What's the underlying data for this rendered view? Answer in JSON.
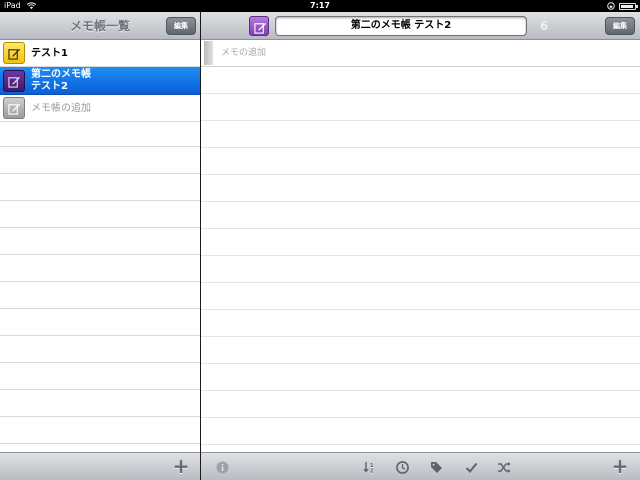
{
  "status_bar": {
    "device": "iPad",
    "time": "7:17"
  },
  "left_pane": {
    "title": "メモ帳一覧",
    "edit_label": "編集",
    "notebooks": [
      {
        "label": "テスト1",
        "icon": "notebook-yellow-icon",
        "color": "#f2c60e"
      },
      {
        "label_line1": "第二のメモ帳",
        "label_line2": "テスト2",
        "icon": "notebook-purple-icon",
        "color": "#4e2480",
        "selected": true
      },
      {
        "label": "メモ帳の追加",
        "icon": "notebook-gray-icon",
        "color": "#a8a8a8"
      }
    ]
  },
  "right_pane": {
    "notebook_title": "第二のメモ帳 テスト2",
    "count": "6",
    "edit_label": "編集",
    "add_note_placeholder": "メモの追加"
  },
  "bottom_toolbar": {
    "left_add": "+",
    "right_add": "+"
  },
  "colors": {
    "selection": "#1478e8",
    "toolbar": "#c8cbd0"
  }
}
